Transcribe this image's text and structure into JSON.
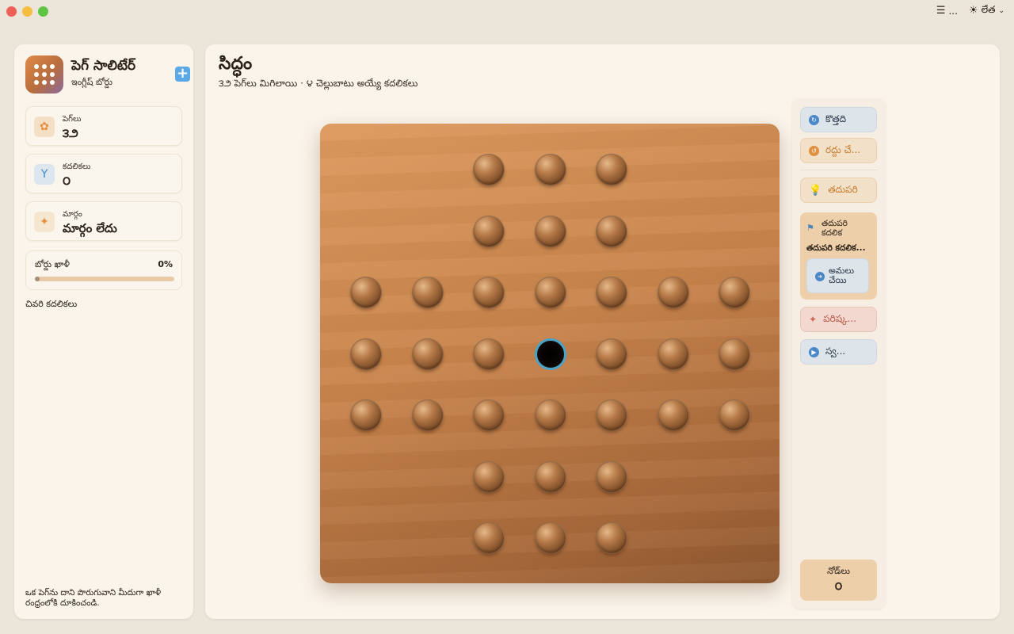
{
  "window": {
    "toolbar": {
      "settings_label": "...",
      "theme_label": "లేత"
    }
  },
  "sidebar": {
    "app_title": "పెగ్ సాలిటేర్",
    "app_subtitle": "ఇంగ్లీష్ బోర్డు",
    "stats": [
      {
        "label": "పెగ్‌లు",
        "value": "౩౨"
      },
      {
        "label": "కదలికలు",
        "value": "౦"
      },
      {
        "label": "మార్గం",
        "value": "మార్గం లేదు"
      }
    ],
    "progress": {
      "label": "బోర్డు ఖాళీ",
      "percent_text": "0%",
      "value": 0
    },
    "recent_moves_title": "చివరి కదలికలు",
    "hint_text": "ఒక పెగ్‌ను దాని పొరుగువాని మీదుగా ఖాళీ రంధ్రంలోకి దూకించండి."
  },
  "main": {
    "title": "సిద్ధం",
    "subtitle": "౩౨ పెగ్‌లు మిగిలాయి · ౪ చెల్లుబాటు అయ్యే కదలికలు"
  },
  "board": {
    "layout": [
      "..ooo..",
      "..ooo..",
      "ooooooo",
      "ooo_ooo",
      "ooooooo",
      "..ooo..",
      "..ooo.."
    ],
    "selected_empty": [
      3,
      3
    ]
  },
  "controls": {
    "new_label": "కొత్తది",
    "undo_label": "రద్దు చే...",
    "hint_label": "తదుపరి",
    "next_move_title": "తదుపరి కదలిక",
    "next_move_text": "తదుపరి కదలిక...",
    "apply_label": "అమలు చేయి",
    "solve_label": "పరిష్క...",
    "auto_label": "స్వ...",
    "nodes_label": "నోడ్‌లు",
    "nodes_value": "౦"
  },
  "colors": {
    "accent_blue": "#4a88c7",
    "accent_orange": "#c47f33",
    "empty_hole_ring": "#4aa3c9",
    "board_wood": "#c8844c"
  }
}
